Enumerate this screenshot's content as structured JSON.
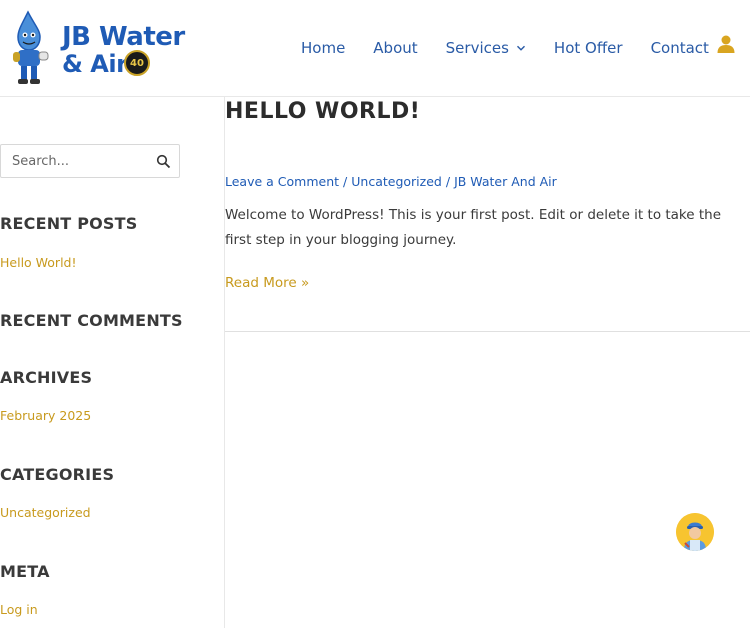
{
  "header": {
    "logo": {
      "line1": "JB Water",
      "line2": "& Air",
      "badge": "40"
    },
    "nav": [
      {
        "label": "Home"
      },
      {
        "label": "About"
      },
      {
        "label": "Services"
      },
      {
        "label": "Hot Offer"
      },
      {
        "label": "Contact"
      }
    ],
    "icons": {
      "services_dropdown": "chevron-down-icon",
      "account": "user-icon"
    }
  },
  "sidebar": {
    "search": {
      "placeholder": "Search...",
      "button_icon": "search-icon"
    },
    "recent_posts": {
      "title": "RECENT POSTS",
      "items": [
        "Hello World!"
      ]
    },
    "recent_comments": {
      "title": "RECENT COMMENTS"
    },
    "archives": {
      "title": "ARCHIVES",
      "items": [
        "February 2025"
      ]
    },
    "categories": {
      "title": "CATEGORIES",
      "items": [
        "Uncategorized"
      ]
    },
    "meta": {
      "title": "META",
      "items": [
        "Log in"
      ]
    }
  },
  "post": {
    "title": "HELLO WORLD!",
    "meta": {
      "comment": "Leave a Comment",
      "category": "Uncategorized",
      "author": "JB Water And Air",
      "separator": "/"
    },
    "body": "Welcome to WordPress! This is your first post. Edit or delete it to take the first step in your blogging journey.",
    "read_more": "Read More »"
  },
  "chat": {
    "icon": "support-agent-icon"
  },
  "colors": {
    "brand_blue": "#1f5bb5",
    "link_gold": "#c89a1e",
    "chat_yellow": "#f7c430"
  }
}
